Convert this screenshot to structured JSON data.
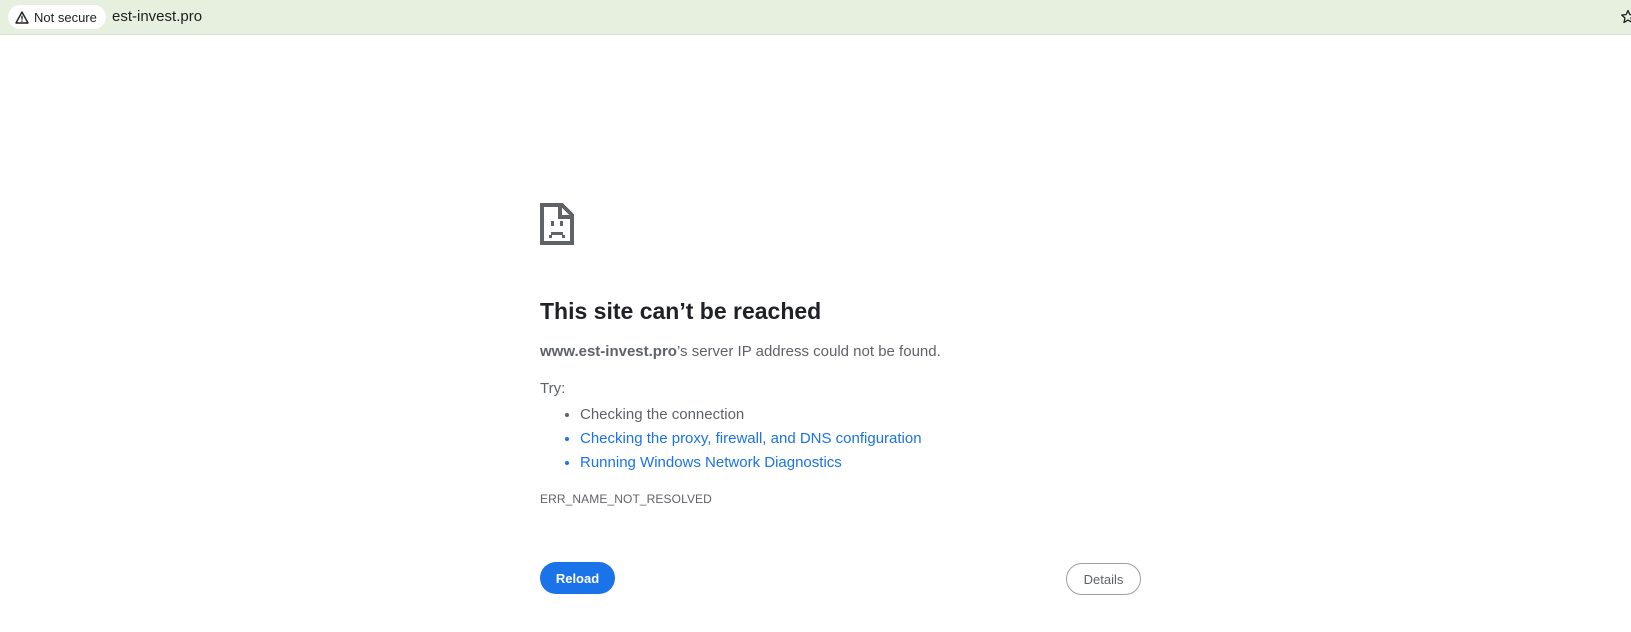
{
  "browser": {
    "security_label": "Not secure",
    "url": "est-invest.pro",
    "icons": {
      "security": "warning-triangle-icon",
      "bookmark": "star-icon"
    }
  },
  "error": {
    "icon": "sad-page-icon",
    "title": "This site can’t be reached",
    "host": "www.est-invest.pro",
    "message_suffix": "’s server IP address could not be found.",
    "try_label": "Try:",
    "suggestions": [
      {
        "text": "Checking the connection",
        "link": false
      },
      {
        "text": "Checking the proxy, firewall, and DNS configuration",
        "link": true
      },
      {
        "text": "Running Windows Network Diagnostics",
        "link": true
      }
    ],
    "code": "ERR_NAME_NOT_RESOLVED"
  },
  "buttons": {
    "reload": "Reload",
    "details": "Details"
  },
  "colors": {
    "accent": "#1a73e8",
    "address_bar_bg": "#e7efdf",
    "text_secondary": "#5f6368",
    "title": "#202124"
  }
}
